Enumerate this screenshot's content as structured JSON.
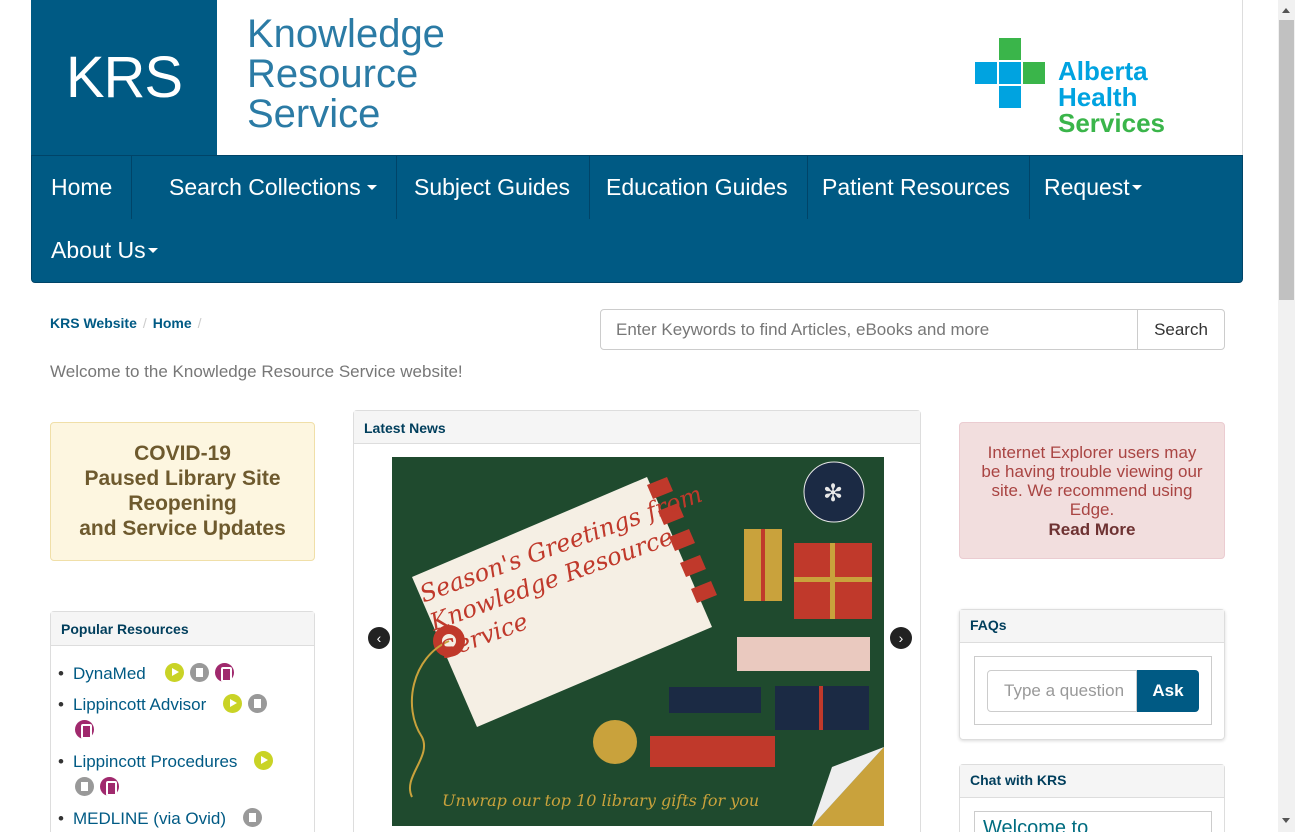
{
  "header": {
    "logo_abbr": "KRS",
    "name_lines": [
      "Knowledge",
      "Resource",
      "Service"
    ],
    "partner_lines": [
      "Alberta Health",
      "Services"
    ]
  },
  "nav": {
    "items": [
      "Home",
      "Search Collections",
      "Subject Guides",
      "Education Guides",
      "Patient Resources",
      "Request",
      "About Us"
    ]
  },
  "breadcrumb": [
    "KRS Website",
    "Home"
  ],
  "search": {
    "placeholder": "Enter Keywords to find Articles, eBooks and more",
    "button": "Search"
  },
  "welcome": "Welcome to the Knowledge Resource Service website!",
  "covid": {
    "lines": [
      "COVID-19",
      "Paused Library Site",
      "Reopening",
      "and Service Updates"
    ]
  },
  "popular": {
    "title": "Popular Resources",
    "items": [
      "DynaMed",
      "Lippincott Advisor",
      "Lippincott Procedures",
      "MEDLINE (via Ovid)"
    ]
  },
  "news": {
    "title": "Latest News",
    "slide_tag": "Season's Greetings from Knowledge Resource Service",
    "slide_bottom": "Unwrap our top 10 library gifts for you"
  },
  "ie_notice": {
    "text": "Internet Explorer users may be having trouble viewing our site. We recommend using Edge.",
    "link": "Read More"
  },
  "faqs": {
    "title": "FAQs",
    "placeholder": "Type a question",
    "button": "Ask"
  },
  "chat": {
    "title": "Chat with KRS",
    "body": "Welcome to"
  },
  "colors": {
    "brand": "#005a84",
    "ahs_blue": "#00a3e0",
    "ahs_green": "#3ab54a"
  }
}
